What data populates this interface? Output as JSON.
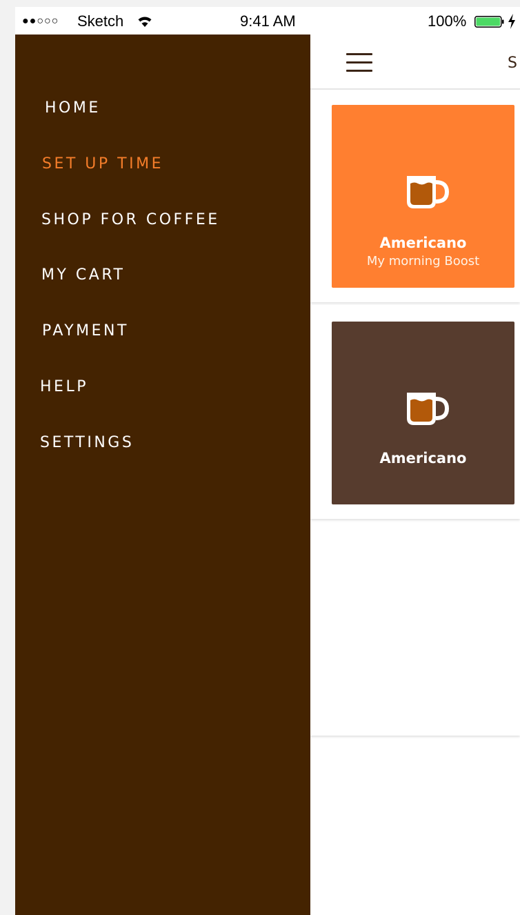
{
  "status_bar": {
    "signal": "●●○○○",
    "carrier": "Sketch",
    "time": "9:41 AM",
    "battery_percent": "100%",
    "battery_level": 1.0,
    "charging_color": "#4cd964"
  },
  "drawer": {
    "background": "#442301",
    "active_color": "#f47d2a",
    "items": [
      {
        "label": "HOME",
        "active": false
      },
      {
        "label": "SET UP TIME",
        "active": true
      },
      {
        "label": "SHOP FOR COFFEE",
        "active": false
      },
      {
        "label": "MY CART",
        "active": false
      },
      {
        "label": "PAYMENT",
        "active": false
      },
      {
        "label": "HELP",
        "active": false
      },
      {
        "label": "SETTINGS",
        "active": false
      }
    ]
  },
  "topbar": {
    "menu_icon": "hamburger-menu-icon",
    "title_fragment": "S"
  },
  "cards": [
    {
      "title": "Americano",
      "subtitle": "My morning Boost",
      "background": "#ff7f30",
      "icon": "coffee-cup-icon"
    },
    {
      "title": "Americano",
      "subtitle": "",
      "background": "#573c2e",
      "icon": "coffee-cup-icon"
    }
  ]
}
